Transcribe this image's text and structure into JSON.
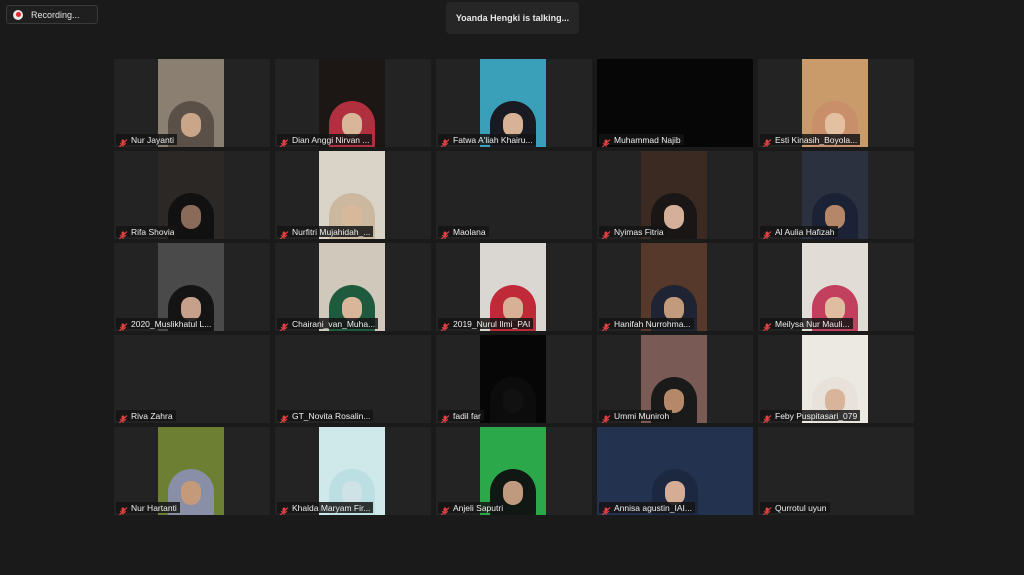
{
  "recording": {
    "label": "Recording...",
    "icon": "record-icon"
  },
  "talking_indicator": "Yoanda Hengki is talking...",
  "participants": [
    {
      "name": "Nur Jayanti",
      "video": true,
      "bg": "#8a7f70",
      "hijab": "#5a5048",
      "face": "#c9a68a",
      "muted": true
    },
    {
      "name": "Dian Anggi Nirvan ...",
      "video": true,
      "bg": "#1c1715",
      "hijab": "#b03040",
      "face": "#d9b599",
      "muted": true
    },
    {
      "name": "Fatwa A'liah Khairu...",
      "video": true,
      "bg": "#3a9fb8",
      "hijab": "#1a1a22",
      "face": "#d7b296",
      "muted": true
    },
    {
      "name": "Muhammad Najib",
      "video": true,
      "wide": true,
      "bg": "#060606",
      "hijab": "#060606",
      "face": "#060606",
      "muted": true
    },
    {
      "name": "Esti Kinasih_Boyola...",
      "video": true,
      "bg": "#c99a6a",
      "hijab": "#c98f6a",
      "face": "#e3c0a0",
      "muted": true
    },
    {
      "name": "Rifa Shovia",
      "video": true,
      "bg": "#2b2826",
      "hijab": "#111",
      "face": "#8a6a58",
      "muted": true
    },
    {
      "name": "Nurfitri Mujahidah_...",
      "video": true,
      "bg": "#d9d3c8",
      "hijab": "#cbb89e",
      "face": "#d8b89a",
      "muted": true
    },
    {
      "name": "Maolana",
      "video": false,
      "muted": true
    },
    {
      "name": "Nyimas Fitria",
      "video": true,
      "bg": "#3a2a22",
      "hijab": "#1a1616",
      "face": "#d4b09a",
      "muted": true
    },
    {
      "name": "Al Aulia Hafizah",
      "video": true,
      "bg": "#2c3140",
      "hijab": "#1c2235",
      "face": "#b68668",
      "muted": true
    },
    {
      "name": "2020_Muslikhatul L...",
      "video": true,
      "bg": "#4a4a4a",
      "hijab": "#141414",
      "face": "#c6a08a",
      "muted": true
    },
    {
      "name": "Chairani_van_Muha...",
      "video": true,
      "bg": "#cfc8bb",
      "hijab": "#1e5a3e",
      "face": "#d9b69a",
      "muted": true
    },
    {
      "name": "2019_Nurul Ilmi_PAI",
      "video": true,
      "bg": "#dad6d2",
      "hijab": "#c02a38",
      "face": "#d8b096",
      "muted": true
    },
    {
      "name": "Hanifah Nurrohma...",
      "video": true,
      "bg": "#56392a",
      "hijab": "#1e2433",
      "face": "#c29a7c",
      "muted": true
    },
    {
      "name": "Meilysa Nur Mauli...",
      "video": true,
      "bg": "#e2dcd6",
      "hijab": "#c2405e",
      "face": "#e0bca0",
      "muted": true
    },
    {
      "name": "Riva Zahra",
      "video": false,
      "muted": true
    },
    {
      "name": "GT_Novita Rosalin...",
      "video": false,
      "muted": true
    },
    {
      "name": "fadil far",
      "video": true,
      "bg": "#060606",
      "hijab": "#0c0c0c",
      "face": "#111111",
      "muted": true
    },
    {
      "name": "Ummi Muniroh",
      "video": true,
      "bg": "#7a5a55",
      "hijab": "#1a1a1a",
      "face": "#b48868",
      "muted": true
    },
    {
      "name": "Feby Puspitasari_079",
      "video": true,
      "bg": "#ece8e2",
      "hijab": "#e8e2da",
      "face": "#d8b59a",
      "muted": true
    },
    {
      "name": "Nur Hartanti",
      "video": true,
      "bg": "#6d7f32",
      "hijab": "#8a8fa8",
      "face": "#c49a7a",
      "muted": true
    },
    {
      "name": "Khalda Maryam Fir...",
      "video": true,
      "bg": "#cfe8ea",
      "hijab": "#bcdfe4",
      "face": "#cfe2e6",
      "muted": true
    },
    {
      "name": "Anjeli Saputri",
      "video": true,
      "bg": "#2aa84a",
      "hijab": "#111814",
      "face": "#c09a7e",
      "muted": true
    },
    {
      "name": "Annisa agustin_IAI...",
      "video": true,
      "hd": true,
      "bg": "#22324f",
      "hijab": "#1c2840",
      "face": "#d5ad94",
      "muted": true
    },
    {
      "name": "Qurrotul uyun",
      "video": false,
      "muted": true
    }
  ]
}
